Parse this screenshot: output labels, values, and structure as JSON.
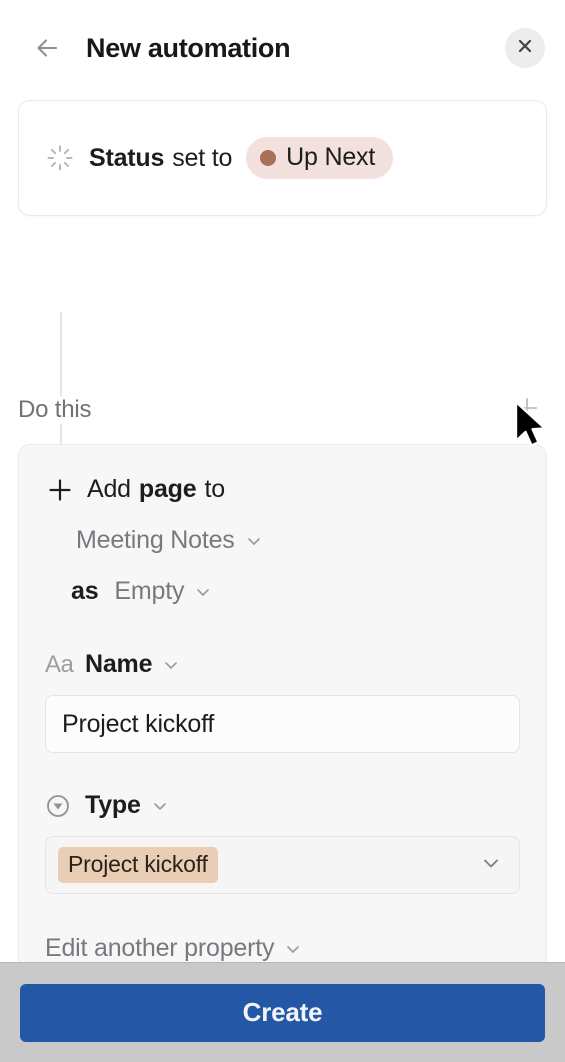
{
  "header": {
    "title": "New automation",
    "back_icon": "arrow-left-icon",
    "close_icon": "close-icon"
  },
  "trigger": {
    "icon": "spinner-status-icon",
    "property_label": "Status",
    "verb": "set to",
    "value_pill": {
      "label": "Up Next",
      "dot_color": "#a9705a",
      "background": "#f2e1dc"
    }
  },
  "do_this": {
    "label": "Do this",
    "add_icon": "plus-icon"
  },
  "action": {
    "add_icon": "plus-icon",
    "verb_prefix": "Add",
    "verb_object": "page",
    "verb_suffix": "to",
    "destination": "Meeting Notes",
    "as_label": "as",
    "template": "Empty",
    "chevron_icon": "chevron-down-icon",
    "properties": [
      {
        "icon": "text-aa-icon",
        "name": "Name",
        "field_type": "text",
        "value": "Project kickoff"
      },
      {
        "icon": "select-circle-icon",
        "name": "Type",
        "field_type": "select",
        "value": "Project kickoff",
        "tag_background": "#e9cdb4"
      }
    ],
    "edit_another_label": "Edit another property"
  },
  "footer": {
    "create_label": "Create",
    "create_color": "#2458a6"
  },
  "cursor": {
    "icon": "mouse-pointer-icon"
  }
}
